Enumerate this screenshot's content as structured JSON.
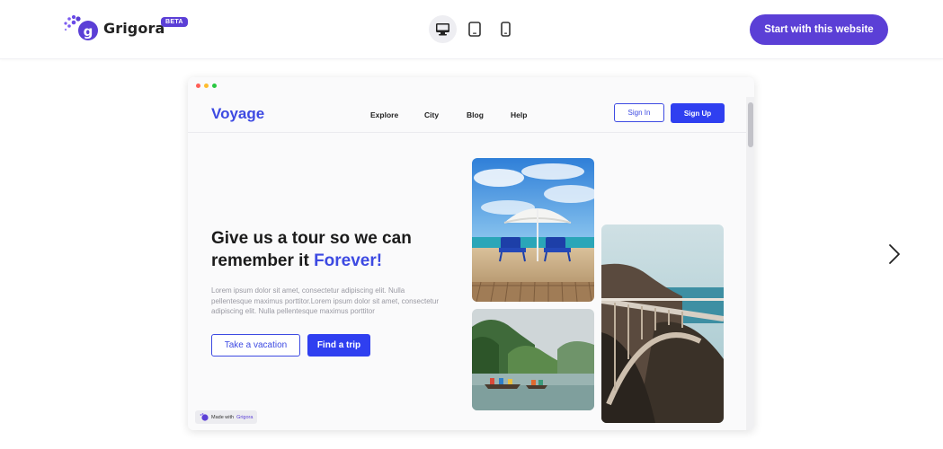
{
  "header": {
    "brand_name": "Grigora",
    "beta_badge": "BETA",
    "devices": [
      {
        "icon": "desktop-icon",
        "active": true
      },
      {
        "icon": "tablet-icon",
        "active": false
      },
      {
        "icon": "mobile-icon",
        "active": false
      }
    ],
    "cta_label": "Start with this website",
    "brand_color": "#5b3fd6"
  },
  "preview": {
    "window_dots": [
      "#ff5f57",
      "#febc2e",
      "#28c840"
    ],
    "site": {
      "brand": "Voyage",
      "nav": [
        "Explore",
        "City",
        "Blog",
        "Help"
      ],
      "sign_in": "Sign In",
      "sign_up": "Sign Up",
      "headline_part1": "Give us a tour so we can remember it",
      "headline_accent": "Forever!",
      "lead": "Lorem ipsum dolor sit amet, consectetur adipiscing elit. Nulla pellentesque maximus porttitor.Lorem ipsum dolor sit amet, consectetur adipiscing elit. Nulla pellentesque maximus porttitor",
      "button_outline": "Take a vacation",
      "button_fill": "Find a trip",
      "accent_color": "#3d4ae2",
      "photos": [
        "beach-umbrella-photo",
        "lake-boat-photo",
        "coastal-bridge-photo"
      ]
    },
    "made_with_prefix": "Made with",
    "made_with_brand": "Grigora"
  },
  "navigation": {
    "next_icon": "chevron-right-icon"
  }
}
